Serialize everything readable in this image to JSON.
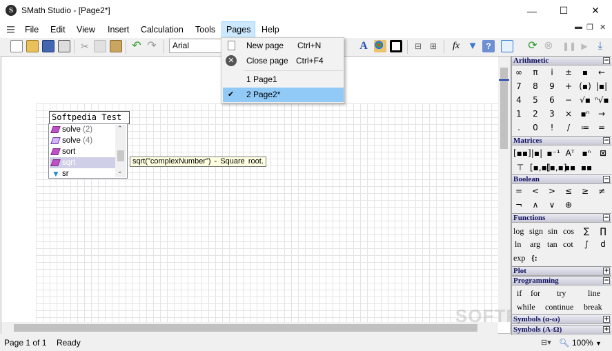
{
  "window": {
    "title": "SMath Studio - [Page2*]",
    "app_icon": "S"
  },
  "menu": [
    "File",
    "Edit",
    "View",
    "Insert",
    "Calculation",
    "Tools",
    "Pages",
    "Help"
  ],
  "toolbar": {
    "font": "Arial"
  },
  "pages_menu": {
    "items": [
      {
        "label": "New page",
        "shortcut": "Ctrl+N"
      },
      {
        "label": "Close page",
        "shortcut": "Ctrl+F4"
      }
    ],
    "pages": [
      {
        "label": "1 Page1",
        "checked": false
      },
      {
        "label": "2 Page2*",
        "checked": true
      }
    ]
  },
  "editor": {
    "input": "Softpedia Test",
    "autocomplete": [
      {
        "name": "solve",
        "count": "(2)",
        "icon": "function-icon"
      },
      {
        "name": "solve",
        "count": "(4)",
        "icon": "function-icon"
      },
      {
        "name": "sort",
        "count": "",
        "icon": "function-icon"
      },
      {
        "name": "sqrt",
        "count": "",
        "icon": "function-icon",
        "selected": true
      },
      {
        "name": "sr",
        "count": "",
        "icon": "funnel-icon"
      }
    ],
    "tooltip": "sqrt(\"complexNumber\") - Square root."
  },
  "status": {
    "page": "Page 1 of 1",
    "state": "Ready",
    "zoom": "100%"
  },
  "panels": {
    "arithmetic": {
      "title": "Arithmetic",
      "rows": [
        [
          "∞",
          "π",
          "i",
          "±",
          "▪",
          "←"
        ],
        [
          "7",
          "8",
          "9",
          "+",
          "(▪)",
          "|▪|"
        ],
        [
          "4",
          "5",
          "6",
          "−",
          "√▪",
          "ⁿ√▪"
        ],
        [
          "1",
          "2",
          "3",
          "×",
          "▪ⁿ",
          "→"
        ],
        [
          ".",
          "0",
          "!",
          "/",
          "≔",
          "="
        ]
      ]
    },
    "matrices": {
      "title": "Matrices"
    },
    "boolean": {
      "title": "Boolean",
      "rows": [
        [
          "=",
          "<",
          ">",
          "≤",
          "≥",
          "≠"
        ],
        [
          "¬",
          "∧",
          "∨",
          "⊕"
        ]
      ]
    },
    "functions": {
      "title": "Functions",
      "rows": [
        [
          "log",
          "sign",
          "sin",
          "cos"
        ],
        [
          "ln",
          "arg",
          "tan",
          "cot"
        ],
        [
          "exp",
          "{:"
        ]
      ]
    },
    "plot": {
      "title": "Plot"
    },
    "programming": {
      "title": "Programming",
      "rows": [
        [
          "if",
          "for",
          "try",
          "line"
        ],
        [
          "while",
          "continue",
          "break"
        ]
      ]
    },
    "symbols_lower": {
      "title": "Symbols (α-ω)"
    },
    "symbols_upper": {
      "title": "Symbols (Α-Ω)"
    }
  },
  "watermark": "SOFTPEDIA"
}
